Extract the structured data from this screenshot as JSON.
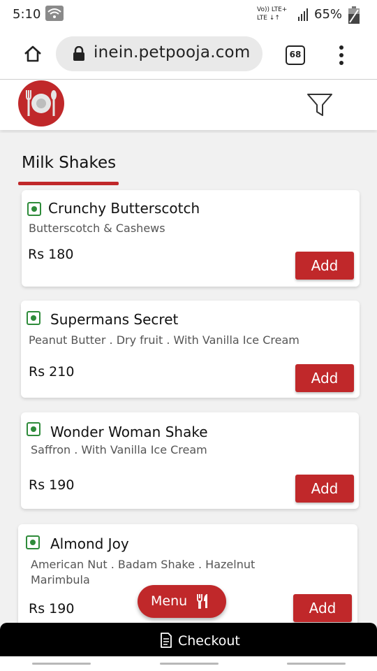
{
  "status_bar": {
    "time": "5:10",
    "network_top": "Vo)) LTE+",
    "network_bottom": "LTE ↓↑",
    "battery": "65%"
  },
  "browser": {
    "url": "inein.petpooja.com",
    "tab_count": "68"
  },
  "section": {
    "title": "Milk Shakes"
  },
  "items": [
    {
      "name": "Crunchy Butterscotch",
      "desc": "Butterscotch & Cashews",
      "price": "Rs 180",
      "add_label": "Add"
    },
    {
      "name": "Supermans Secret",
      "desc": "Peanut Butter . Dry fruit . With Vanilla Ice Cream",
      "price": "Rs 210",
      "add_label": "Add"
    },
    {
      "name": "Wonder Woman Shake",
      "desc": "Saffron . With Vanilla Ice Cream",
      "price": "Rs 190",
      "add_label": "Add"
    },
    {
      "name": "Almond Joy",
      "desc": "American Nut . Badam Shake . Hazelnut Marimbula",
      "price": "Rs 190",
      "add_label": "Add"
    }
  ],
  "menu_button": {
    "label": "Menu"
  },
  "checkout": {
    "label": "Checkout"
  },
  "colors": {
    "accent": "#c0282a",
    "veg": "#2e8b3a"
  },
  "icons": [
    "wifi-icon",
    "signal-icon",
    "battery-icon",
    "home-icon",
    "lock-icon",
    "tabs-icon",
    "kebab-icon",
    "logo",
    "filter-icon",
    "veg-icon",
    "cutlery-icon",
    "document-icon"
  ]
}
